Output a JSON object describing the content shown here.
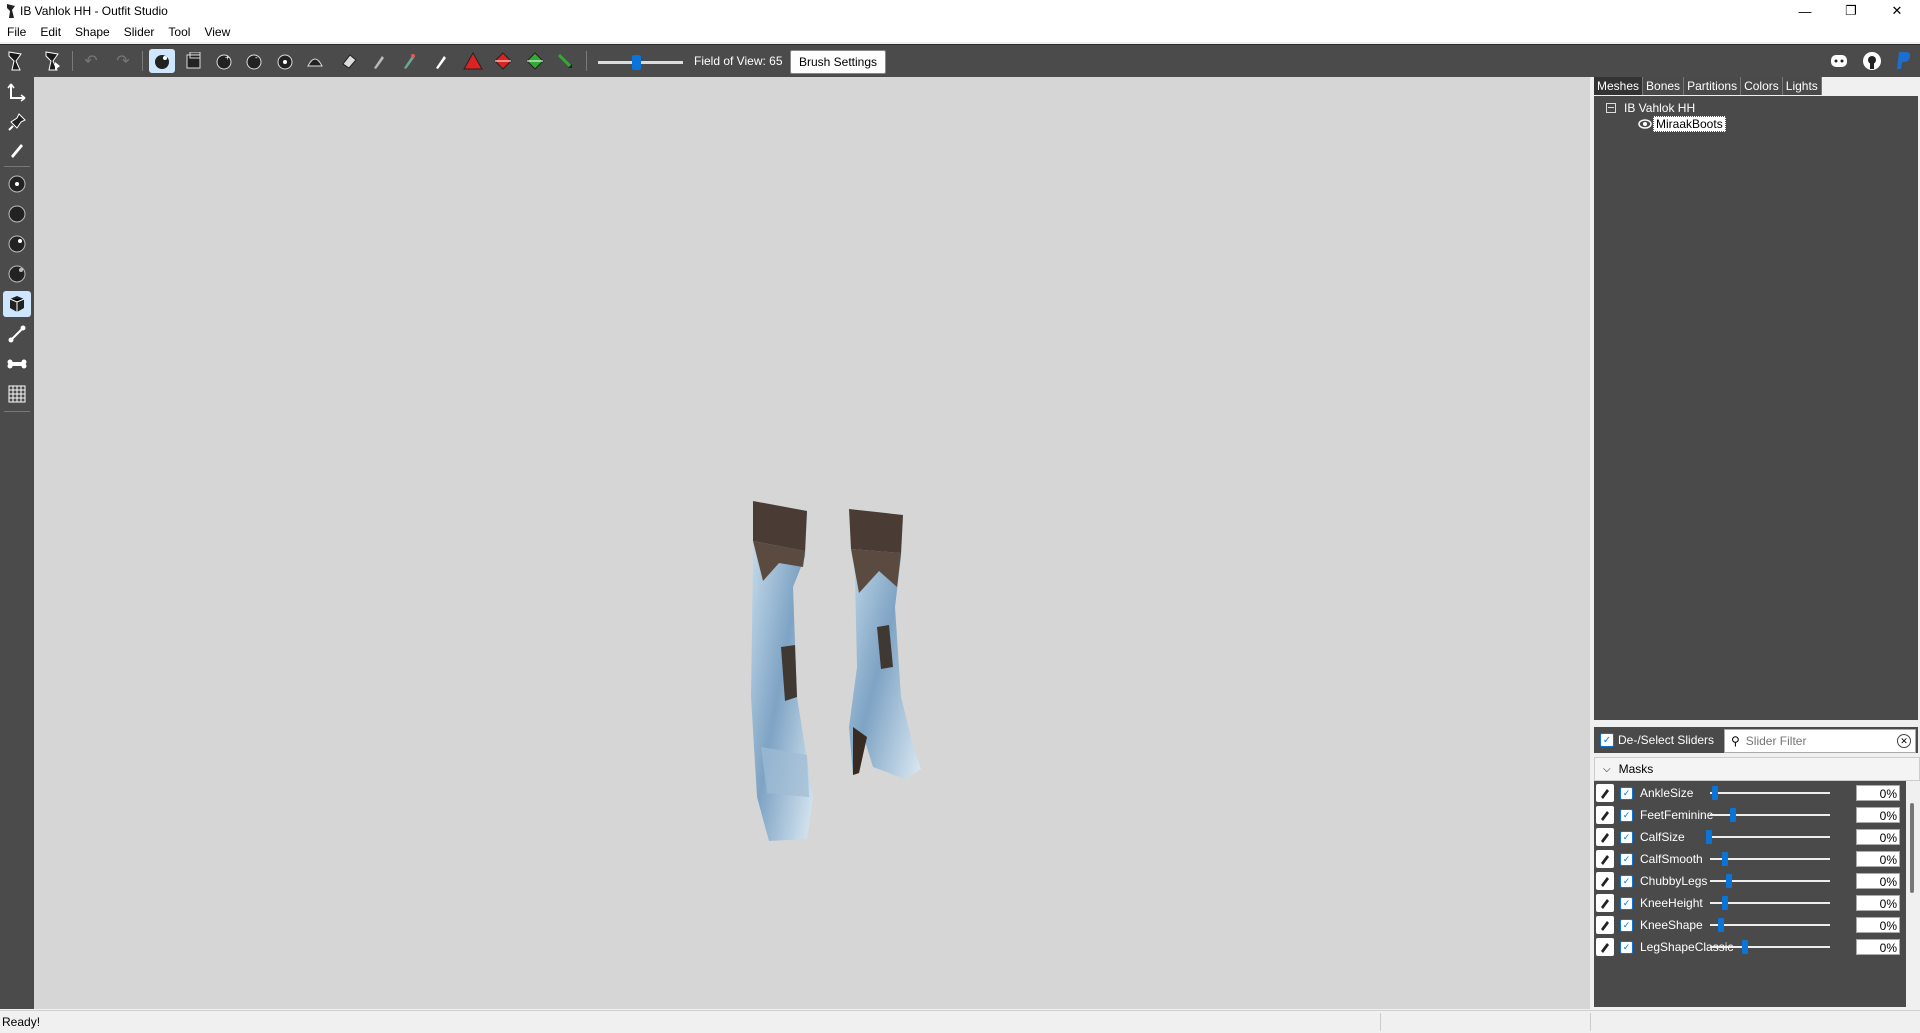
{
  "window": {
    "title": "IB Vahlok HH - Outfit Studio"
  },
  "menu": [
    "File",
    "Edit",
    "Shape",
    "Slider",
    "Tool",
    "View"
  ],
  "toolbar": {
    "fov_label": "Field of View: 65",
    "fov_value": 65,
    "brush_settings": "Brush Settings"
  },
  "right_panel": {
    "tabs": [
      "Meshes",
      "Bones",
      "Partitions",
      "Colors",
      "Lights"
    ],
    "tree": {
      "root": "IB Vahlok HH",
      "mesh": "MiraakBoots"
    },
    "deselect_label": "De-/Select Sliders",
    "filter_placeholder": "Slider Filter",
    "masks_label": "Masks",
    "sliders": [
      {
        "name": "AnkleSize",
        "value": "0%"
      },
      {
        "name": "FeetFeminine",
        "value": "0%"
      },
      {
        "name": "CalfSize",
        "value": "0%"
      },
      {
        "name": "CalfSmooth",
        "value": "0%"
      },
      {
        "name": "ChubbyLegs",
        "value": "0%"
      },
      {
        "name": "KneeHeight",
        "value": "0%"
      },
      {
        "name": "KneeShape",
        "value": "0%"
      },
      {
        "name": "LegShapeClassic",
        "value": "0%"
      }
    ]
  },
  "status": {
    "text": "Ready!"
  },
  "colors": {
    "accent": "#0a74d9",
    "panel": "#4a4a4a",
    "viewport": "#d6d6d6"
  }
}
